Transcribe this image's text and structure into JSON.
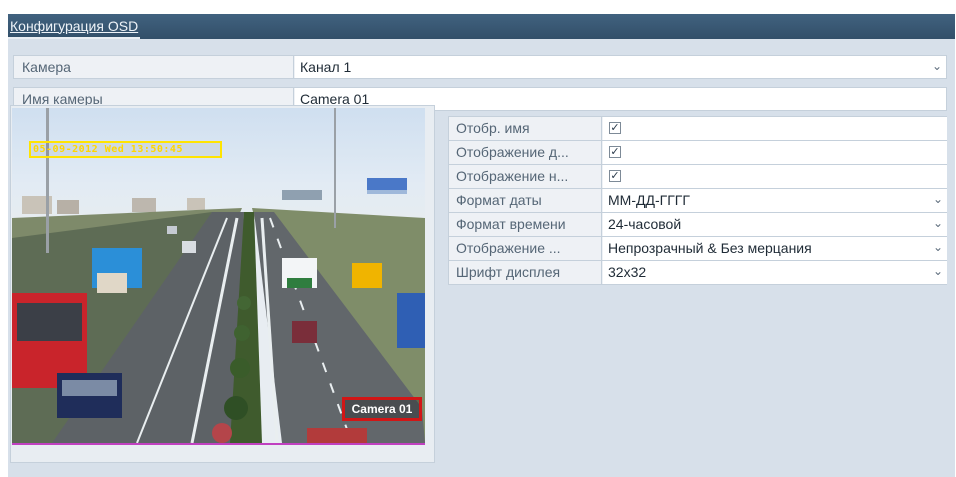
{
  "window": {
    "tab_title": "Конфигурация OSD"
  },
  "camera_row": {
    "label": "Камера",
    "value": "Канал 1"
  },
  "camera_name_row": {
    "label": "Имя камеры",
    "value": "Camera 01"
  },
  "preview": {
    "osd_datetime": "05-09-2012 Wed 13:50:45",
    "osd_camera_name": "Camera 01"
  },
  "settings": [
    {
      "label": "Отобр. имя",
      "type": "checkbox",
      "checked": true
    },
    {
      "label": "Отображение д...",
      "type": "checkbox",
      "checked": true
    },
    {
      "label": "Отображение н...",
      "type": "checkbox",
      "checked": true
    },
    {
      "label": "Формат даты",
      "type": "select",
      "value": "ММ-ДД-ГГГГ"
    },
    {
      "label": "Формат времени",
      "type": "select",
      "value": "24-часовой"
    },
    {
      "label": "Отображение ...",
      "type": "select",
      "value": "Непрозрачный & Без мерцания"
    },
    {
      "label": "Шрифт дисплея",
      "type": "select",
      "value": "32x32"
    }
  ],
  "icons": {
    "dropdown": "chevron-down-icon",
    "check": "checkmark-icon"
  },
  "colors": {
    "titlebar": "#3d5c78",
    "panel_bg": "#d7e0ea",
    "date_box": "#ffe400",
    "name_box": "#d11616"
  }
}
